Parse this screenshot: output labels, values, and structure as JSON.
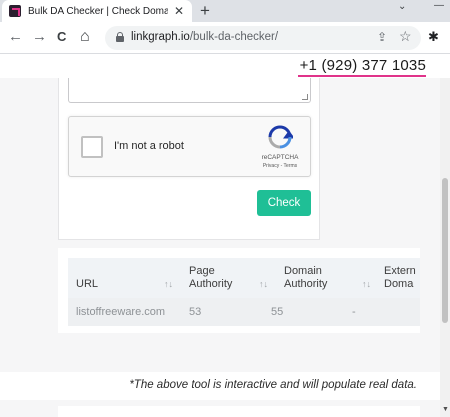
{
  "browser": {
    "tab_title": "Bulk DA Checker | Check Domain Authority",
    "tab_close": "✕",
    "new_tab": "+",
    "window_minimize": "⌄",
    "window_dash": "—",
    "url_domain": "linkgraph.io",
    "url_path": "/bulk-da-checker/",
    "back_icon": "←",
    "forward_icon": "→",
    "reload_icon": "C",
    "home_icon": "⌂",
    "share_icon": "⇪",
    "star_icon": "☆",
    "extensions_icon": "✱"
  },
  "header": {
    "phone": "+1 (929) 377 1035"
  },
  "recaptcha": {
    "label": "I'm not a robot",
    "brand": "reCAPTCHA",
    "links": "Privacy - Terms"
  },
  "form": {
    "check_button": "Check"
  },
  "table": {
    "columns": [
      {
        "line1": "URL",
        "line2": ""
      },
      {
        "line1": "Page",
        "line2": "Authority"
      },
      {
        "line1": "Domain",
        "line2": "Authority"
      },
      {
        "line1": "Extern",
        "line2": "Doma"
      }
    ],
    "sort_icon": "↑↓",
    "rows": [
      {
        "url": "listoffreeware.com",
        "page_authority": "53",
        "domain_authority": "55",
        "external": "-"
      }
    ]
  },
  "note": "*The above tool is interactive and will populate real data.",
  "colors": {
    "accent_pink": "#e0338a",
    "button_green": "#1fbf96"
  }
}
